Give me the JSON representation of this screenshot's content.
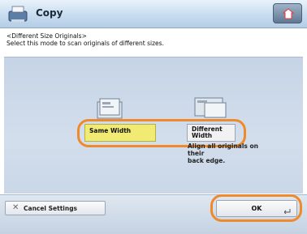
{
  "header": {
    "title": "Copy",
    "copy_icon": "copy-machine-icon",
    "home_icon": "home-icon"
  },
  "mode": {
    "heading": "<Different Size Originals>",
    "subheading": "Select this mode to scan originals of different sizes."
  },
  "options": [
    {
      "label": "Same Width",
      "icon": "stacked-originals-same-width-icon",
      "selected": true
    },
    {
      "label_line1": "Different",
      "label_line2": "Width",
      "icon": "stacked-originals-different-width-icon",
      "selected": false,
      "description_line1": "Align all originals on their",
      "description_line2": "back edge."
    }
  ],
  "footer": {
    "cancel_label": "Cancel Settings",
    "cancel_icon": "close-icon",
    "ok_label": "OK",
    "ok_icon": "enter-arrow-icon"
  },
  "colors": {
    "selected": "#f1ea73",
    "highlight_ring": "#ef8a2c"
  }
}
